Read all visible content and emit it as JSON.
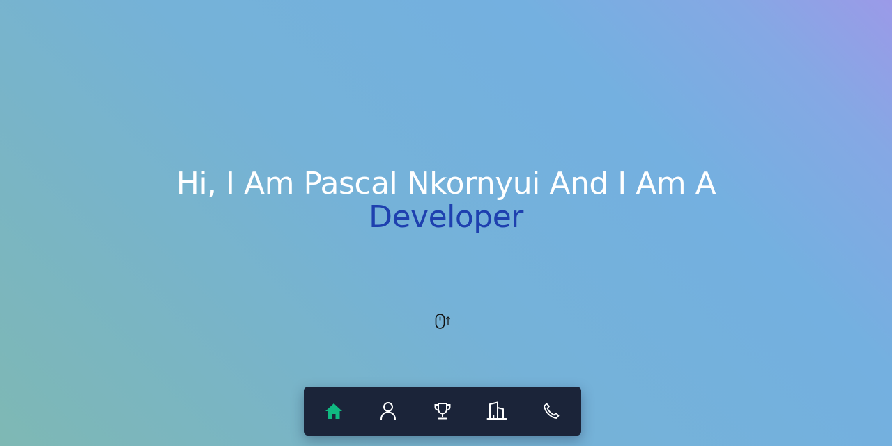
{
  "hero": {
    "intro": "Hi, I Am Pascal Nkornyui And I Am A",
    "role": "Developer"
  },
  "scroll_hint": {
    "icon": "mouse-scroll-icon"
  },
  "dock": {
    "active": "home",
    "items": [
      {
        "id": "home",
        "icon": "home-icon"
      },
      {
        "id": "about",
        "icon": "user-icon"
      },
      {
        "id": "achievements",
        "icon": "trophy-icon"
      },
      {
        "id": "experience",
        "icon": "building-icon"
      },
      {
        "id": "contact",
        "icon": "phone-icon"
      }
    ]
  },
  "colors": {
    "heading": "#ffffff",
    "accent_text": "#1e40af",
    "active_icon": "#10b981",
    "icon": "#ffffff",
    "dock_bg": "#1b2439"
  }
}
